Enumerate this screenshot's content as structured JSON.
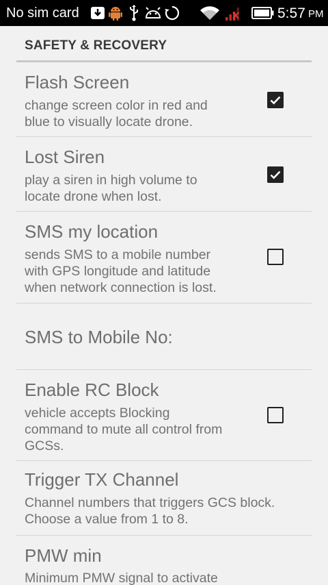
{
  "status_bar": {
    "carrier": "No sim card",
    "time": "5:57",
    "ampm": "PM"
  },
  "section": {
    "title": "SAFETY & RECOVERY"
  },
  "prefs": [
    {
      "title": "Flash Screen",
      "summary_lines": [
        "change screen color in red and",
        "blue to visually locate drone."
      ],
      "checked": true
    },
    {
      "title": "Lost Siren",
      "summary_lines": [
        "play a siren in high volume to",
        "locate drone when lost."
      ],
      "checked": true
    },
    {
      "title": "SMS my location",
      "summary_lines": [
        "sends SMS to a mobile number",
        "with GPS longitude and latitude",
        "when network connection is lost."
      ],
      "checked": false
    },
    {
      "title": "SMS to Mobile No:"
    },
    {
      "title": "Enable RC Block",
      "summary_lines": [
        "vehicle accepts Blocking",
        "command to mute all control from",
        "GCSs."
      ],
      "checked": false
    },
    {
      "title": "Trigger TX Channel",
      "summary_lines": [
        "Channel numbers that triggers GCS block.",
        "Choose a value from 1 to 8."
      ]
    },
    {
      "title": "PMW min",
      "summary_lines": [
        "Minimum PMW signal to activate"
      ]
    }
  ],
  "colors": {
    "background": "#f1f1f1",
    "status_bar": "#000000",
    "title_text": "#6e6e6e",
    "summary_text": "#727272",
    "divider": "#d5d5d5",
    "signal_alert": "#c62828"
  },
  "icons": [
    "download-icon",
    "android-debug-icon",
    "usb-icon",
    "android-icon",
    "sync-icon",
    "wifi-icon",
    "signal-icon",
    "battery-icon"
  ]
}
